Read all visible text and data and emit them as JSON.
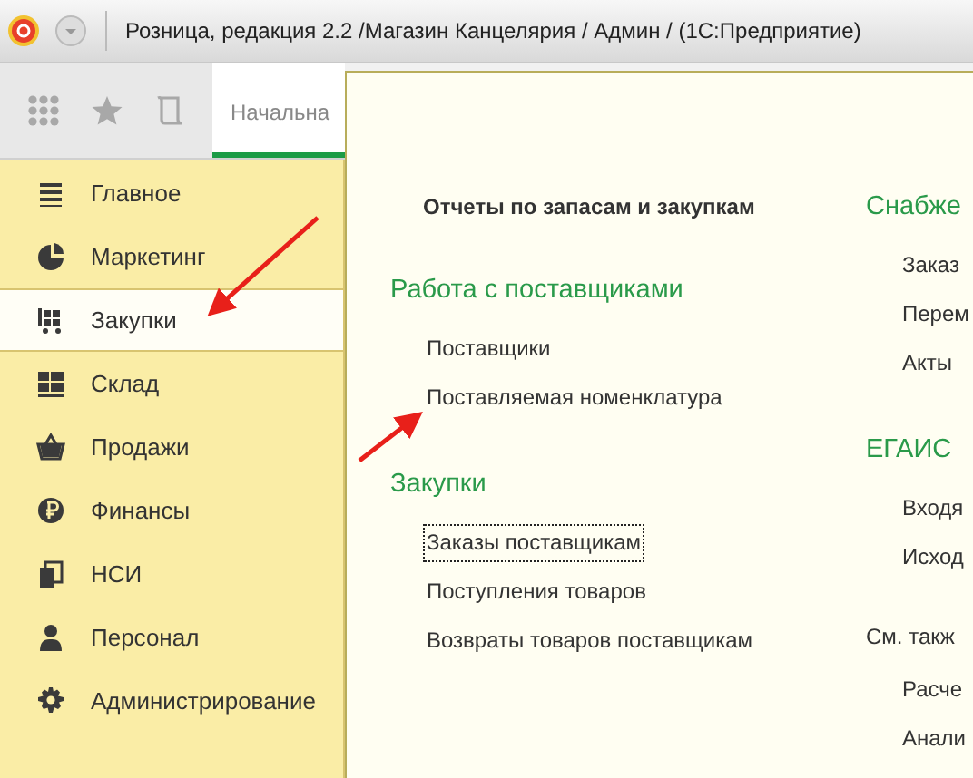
{
  "window": {
    "title": "Розница, редакция 2.2 /Магазин Канцелярия / Админ /  (1С:Предприятие)"
  },
  "toolbar": {
    "tab": {
      "label": "Начальна",
      "selected": true
    }
  },
  "sidebar": {
    "items": [
      {
        "label": "Главное",
        "selected": false
      },
      {
        "label": "Маркетинг",
        "selected": false
      },
      {
        "label": "Закупки",
        "selected": true
      },
      {
        "label": "Склад",
        "selected": false
      },
      {
        "label": "Продажи",
        "selected": false
      },
      {
        "label": "Финансы",
        "selected": false
      },
      {
        "label": "НСИ",
        "selected": false
      },
      {
        "label": "Персонал",
        "selected": false
      },
      {
        "label": "Администрирование",
        "selected": false
      }
    ]
  },
  "panel": {
    "columns": [
      {
        "entries": [
          {
            "kind": "report",
            "text": "Отчеты по запасам и закупкам"
          },
          {
            "kind": "group",
            "text": "Работа с поставщиками"
          },
          {
            "kind": "link",
            "text": "Поставщики",
            "focused": false
          },
          {
            "kind": "link",
            "text": "Поставляемая номенклатура",
            "focused": false
          },
          {
            "kind": "group",
            "text": "Закупки"
          },
          {
            "kind": "link",
            "text": "Заказы поставщикам",
            "focused": true
          },
          {
            "kind": "link",
            "text": "Поступления товаров",
            "focused": false
          },
          {
            "kind": "link",
            "text": "Возвраты товаров поставщикам",
            "focused": false
          }
        ]
      },
      {
        "entries": [
          {
            "kind": "group",
            "text": "Снабже"
          },
          {
            "kind": "link",
            "text": "Заказ",
            "focused": false
          },
          {
            "kind": "link",
            "text": "Перем",
            "focused": false
          },
          {
            "kind": "link",
            "text": "Акты",
            "focused": false
          },
          {
            "kind": "group",
            "text": "ЕГАИС"
          },
          {
            "kind": "link",
            "text": "Входя",
            "focused": false
          },
          {
            "kind": "link",
            "text": "Исход",
            "focused": false
          },
          {
            "kind": "see_also",
            "text": "См. такж"
          },
          {
            "kind": "link",
            "text": "Расче",
            "focused": false
          },
          {
            "kind": "link",
            "text": "Анали",
            "focused": false
          }
        ]
      }
    ]
  }
}
